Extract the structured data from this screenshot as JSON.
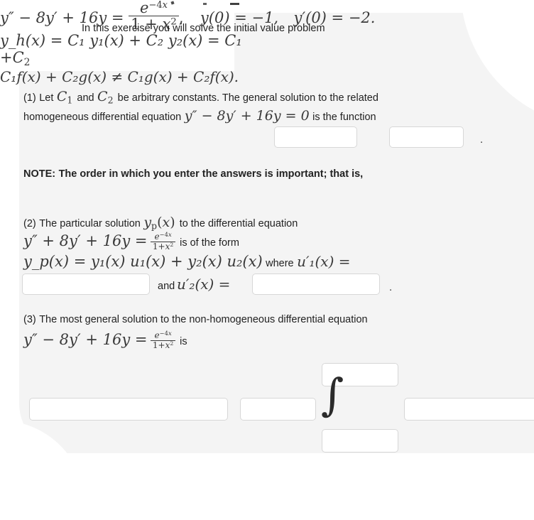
{
  "page": {
    "background_color": "#ffffff",
    "panel_color": "#f4f4f4",
    "text_color": "#222222",
    "math_color": "#3a3a3a",
    "input_border_color": "#d7d7d7",
    "input_fill_color": "#ffffff"
  },
  "intro": {
    "line": "In this exercise you will solve the initial value problem",
    "equation": {
      "lhs": "y″ − 8y′ + 16y =",
      "rhs_numerator": "e^{-4x}",
      "rhs_denominator": "1 + x²",
      "initial_condition_1": "y(0) = −1,",
      "initial_condition_2": "y′(0) = −2."
    }
  },
  "part1": {
    "number": "(1)",
    "text_a": "Let",
    "c1": "C",
    "c1_sub": "1",
    "text_b": "and",
    "c2": "C",
    "c2_sub": "2",
    "text_c": "be arbitrary constants. The general solution to the related",
    "text_d": "homogeneous differential equation",
    "homogeneous_equation": "y″ − 8y′ + 16y = 0",
    "text_e": "is the function",
    "solution_form": "y_h(x) = C₁ y₁(x) + C₂ y₂(x) = C₁",
    "plus_c2": "+C",
    "plus_c2_sub": "2",
    "trailing_period": ".",
    "answer_boxes": [
      {
        "name": "y1-answer-input",
        "value": "",
        "placeholder": ""
      },
      {
        "name": "y2-answer-input",
        "value": "",
        "placeholder": ""
      }
    ]
  },
  "note": {
    "label": "NOTE:",
    "text": "The order in which you enter the answers is important; that is,",
    "inequality": "C₁f(x) + C₂g(x) ≠ C₁g(x) + C₂f(x)."
  },
  "part2": {
    "number": "(2)",
    "text_a": "The particular solution",
    "yp": "y_p(x)",
    "text_b": "to the differential equation",
    "equation_lhs": "y″ + 8y′ + 16y =",
    "equation_numerator": "e^{-4x}",
    "equation_denominator": "1+x²",
    "text_c": "is of the form",
    "form": "y_p(x) = y₁(x) u₁(x) + y₂(x) u₂(x)",
    "text_d": "where",
    "u1_prime": "u′₁(x) =",
    "text_and": "and",
    "u2_prime": "u′₂(x) =",
    "trailing_period": ".",
    "answer_boxes": [
      {
        "name": "u1-prime-answer-input",
        "value": "",
        "placeholder": ""
      },
      {
        "name": "u2-prime-answer-input",
        "value": "",
        "placeholder": ""
      }
    ]
  },
  "part3": {
    "number": "(3)",
    "text_a": "The most general solution to the non-homogeneous differential equation",
    "equation_lhs": "y″ − 8y′ + 16y =",
    "equation_numerator": "e^{-4x}",
    "equation_denominator": "1+x²",
    "text_b": "is",
    "integral_symbol": "∫",
    "answer_boxes": [
      {
        "name": "general-solution-term1-input",
        "value": "",
        "placeholder": ""
      },
      {
        "name": "general-solution-term2-input",
        "value": "",
        "placeholder": ""
      },
      {
        "name": "integral-upper-limit-input",
        "value": "",
        "placeholder": ""
      },
      {
        "name": "integral-lower-limit-input",
        "value": "",
        "placeholder": ""
      },
      {
        "name": "integrand-input",
        "value": "",
        "placeholder": ""
      }
    ]
  }
}
